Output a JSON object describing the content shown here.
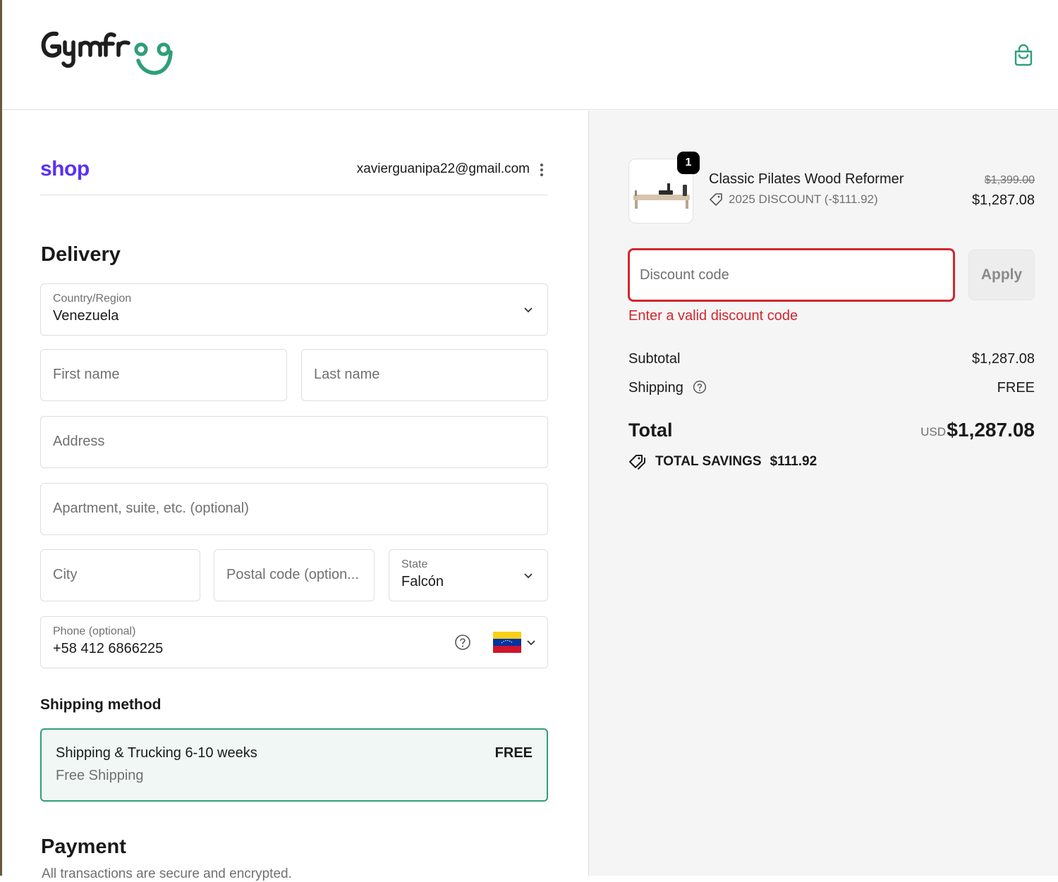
{
  "brand": {
    "name": "Gymfrog"
  },
  "shop": {
    "logo_text": "shop",
    "email": "xavierguanipa22@gmail.com"
  },
  "delivery": {
    "title": "Delivery",
    "country": {
      "label": "Country/Region",
      "value": "Venezuela"
    },
    "first_name": {
      "placeholder": "First name"
    },
    "last_name": {
      "placeholder": "Last name"
    },
    "address": {
      "placeholder": "Address"
    },
    "apartment": {
      "placeholder": "Apartment, suite, etc. (optional)"
    },
    "city": {
      "placeholder": "City"
    },
    "postal": {
      "placeholder": "Postal code (option..."
    },
    "state": {
      "label": "State",
      "value": "Falcón"
    },
    "phone": {
      "label": "Phone (optional)",
      "value": "+58 412 6866225"
    }
  },
  "shipping_method": {
    "title": "Shipping method",
    "option": {
      "name": "Shipping & Trucking 6-10 weeks",
      "description": "Free Shipping",
      "price": "FREE"
    }
  },
  "payment": {
    "title": "Payment",
    "note": "All transactions are secure and encrypted."
  },
  "order": {
    "item": {
      "quantity": "1",
      "name": "Classic Pilates Wood Reformer",
      "discount": "2025 DISCOUNT (-$111.92)",
      "original_price": "$1,399.00",
      "price": "$1,287.08"
    },
    "discount_code": {
      "placeholder": "Discount code",
      "apply_label": "Apply",
      "error": "Enter a valid discount code"
    },
    "subtotal": {
      "label": "Subtotal",
      "value": "$1,287.08"
    },
    "shipping": {
      "label": "Shipping",
      "value": "FREE"
    },
    "total": {
      "label": "Total",
      "currency": "USD",
      "value": "$1,287.08"
    },
    "savings": {
      "label": "TOTAL SAVINGS",
      "value": "$111.92"
    }
  },
  "colors": {
    "accent": "#2f9e7a",
    "error": "#d3262e",
    "shop_brand": "#5a31f4"
  }
}
